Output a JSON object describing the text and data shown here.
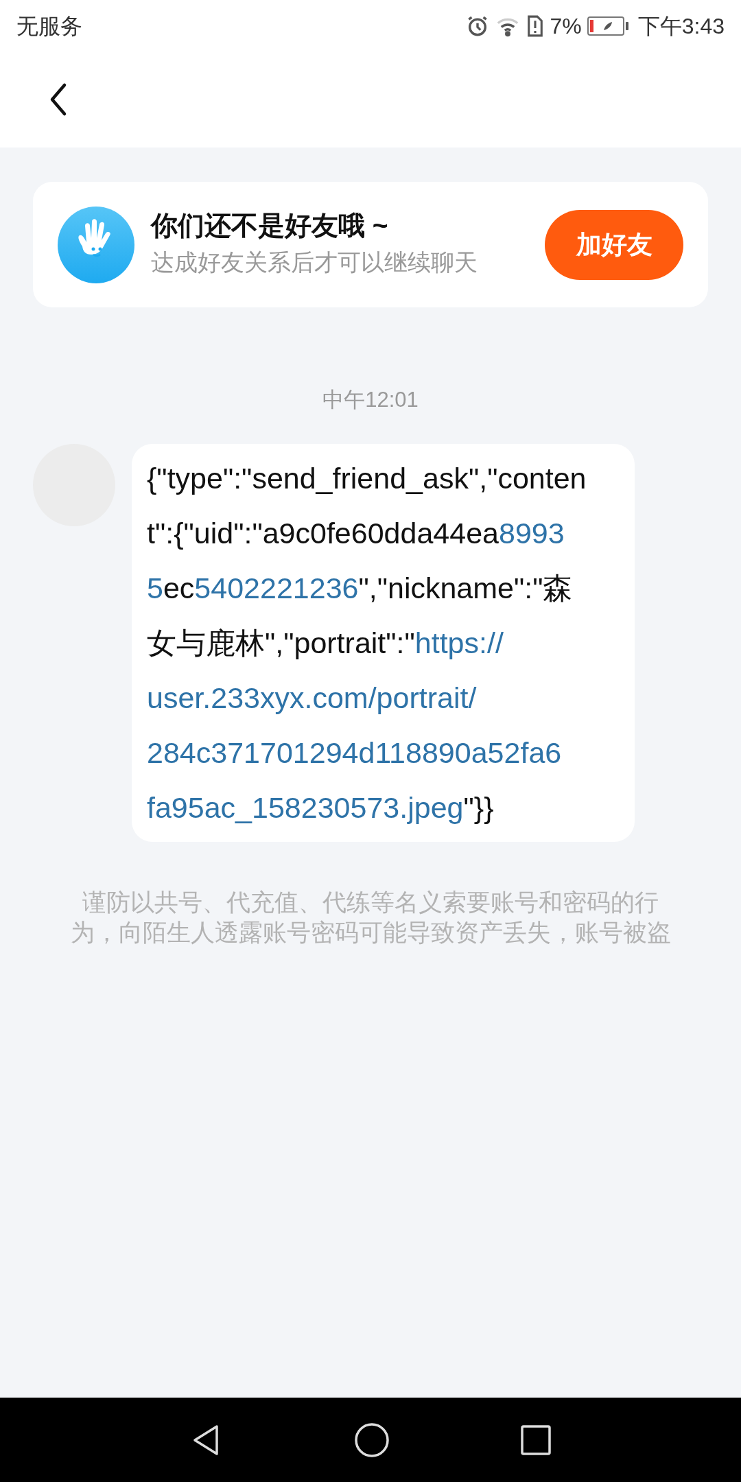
{
  "status_bar": {
    "carrier": "无服务",
    "battery_percent": "7%",
    "time": "下午3:43"
  },
  "friend_notice": {
    "title": "你们还不是好友哦 ~",
    "subtitle": "达成好友关系后才可以继续聊天",
    "button": "加好友"
  },
  "messages": [
    {
      "time": "中午12:01",
      "lines": [
        [
          {
            "kind": "plain",
            "text": "{\"type\":\"send_friend_ask\",\"conten"
          }
        ],
        [
          {
            "kind": "plain",
            "text": "t\":{\"uid\":\"a9c0fe60dda44ea"
          },
          {
            "kind": "link",
            "text": "8993"
          }
        ],
        [
          {
            "kind": "link",
            "text": "5"
          },
          {
            "kind": "plain",
            "text": "ec"
          },
          {
            "kind": "link",
            "text": "5402221236"
          },
          {
            "kind": "plain",
            "text": "\",\"nickname\":\"森"
          }
        ],
        [
          {
            "kind": "plain",
            "text": "女与鹿林\",\"portrait\":\""
          },
          {
            "kind": "link",
            "text": "https://"
          }
        ],
        [
          {
            "kind": "link",
            "text": "user.233xyx.com/portrait/"
          }
        ],
        [
          {
            "kind": "link",
            "text": "284c371701294d118890a52fa6"
          }
        ],
        [
          {
            "kind": "link",
            "text": "fa95ac_158230573.jpeg"
          },
          {
            "kind": "plain",
            "text": "\"}}"
          }
        ]
      ]
    }
  ],
  "warning": "谨防以共号、代充值、代练等名义索要账号和密码的行为，向陌生人透露账号密码可能导致资产丢失，账号被盗"
}
